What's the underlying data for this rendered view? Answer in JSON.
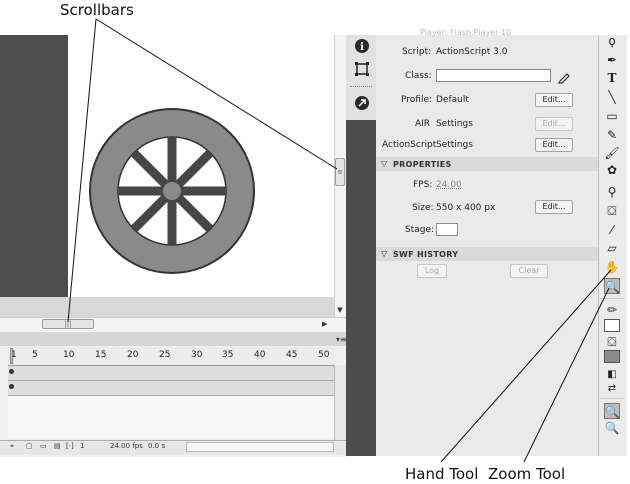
{
  "callouts": {
    "scrollbars": "Scrollbars",
    "hand_tool": "Hand Tool",
    "zoom_tool": "Zoom Tool"
  },
  "timeline": {
    "ticks": [
      "1",
      "5",
      "10",
      "15",
      "20",
      "25",
      "30",
      "35",
      "40",
      "45",
      "50"
    ],
    "footer": {
      "frame": "1",
      "fps": "24.00 fps",
      "time": "0.0 s"
    }
  },
  "properties": {
    "header_faded": "Player: Flash Player 10",
    "script_label": "Script:",
    "script_value": "ActionScript 3.0",
    "class_label": "Class:",
    "class_value": "",
    "profile_label": "Profile:",
    "profile_value": "Default",
    "edit_label": "Edit...",
    "air_label": "AIR",
    "air_value": "Settings",
    "as_label": "ActionScript",
    "as_value": "Settings",
    "section_properties": "PROPERTIES",
    "fps_label": "FPS:",
    "fps_value": "24.00",
    "size_label": "Size:",
    "size_value": "550 x 400 px",
    "stage_label": "Stage:",
    "section_swf": "SWF HISTORY",
    "log_label": "Log",
    "clear_label": "Clear"
  },
  "colors": {
    "wheel_tire": "#8a8a8a",
    "wheel_spokes": "#464646",
    "pasteboard": "#4d4d4d",
    "panel_bg": "#eaeaea"
  },
  "icons": [
    "info-icon",
    "transform-icon",
    "motion-editor-icon"
  ],
  "tools": [
    "lasso-icon",
    "pen-icon",
    "text-icon",
    "line-icon",
    "rectangle-icon",
    "pencil-icon",
    "brush-icon",
    "deco-icon",
    "bone-icon",
    "paint-bucket-icon",
    "eyedropper-icon",
    "eraser-icon",
    "hand-icon",
    "zoom-icon"
  ]
}
